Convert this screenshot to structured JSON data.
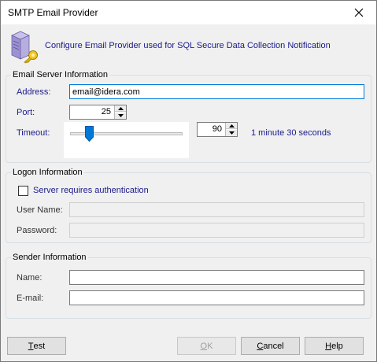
{
  "window": {
    "title": "SMTP Email Provider"
  },
  "header": {
    "text": "Configure Email Provider used for SQL Secure Data Collection Notification",
    "icon": "server-key-icon"
  },
  "email_server": {
    "legend": "Email Server Information",
    "address_label": "Address:",
    "address_value": "email@idera.com",
    "port_label": "Port:",
    "port_value": "25",
    "timeout_label": "Timeout:",
    "timeout_value": "90",
    "timeout_text": "1 minute 30 seconds",
    "timeout_slider_fraction": 0.17
  },
  "logon": {
    "legend": "Logon Information",
    "requires_auth_label": "Server requires authentication",
    "requires_auth_checked": false,
    "username_label": "User Name:",
    "username_value": "",
    "password_label": "Password:",
    "password_value": ""
  },
  "sender": {
    "legend": "Sender Information",
    "name_label": "Name:",
    "name_value": "",
    "email_label": "E-mail:",
    "email_value": ""
  },
  "buttons": {
    "test": {
      "mnemonic": "T",
      "rest": "est"
    },
    "ok": {
      "mnemonic": "O",
      "rest": "K"
    },
    "cancel": {
      "mnemonic": "C",
      "rest": "ancel"
    },
    "help": {
      "mnemonic": "H",
      "rest": "elp"
    }
  },
  "colors": {
    "accent_text": "#1a1a8c",
    "focus_border": "#0078d7",
    "slider_thumb": "#0078d7"
  }
}
